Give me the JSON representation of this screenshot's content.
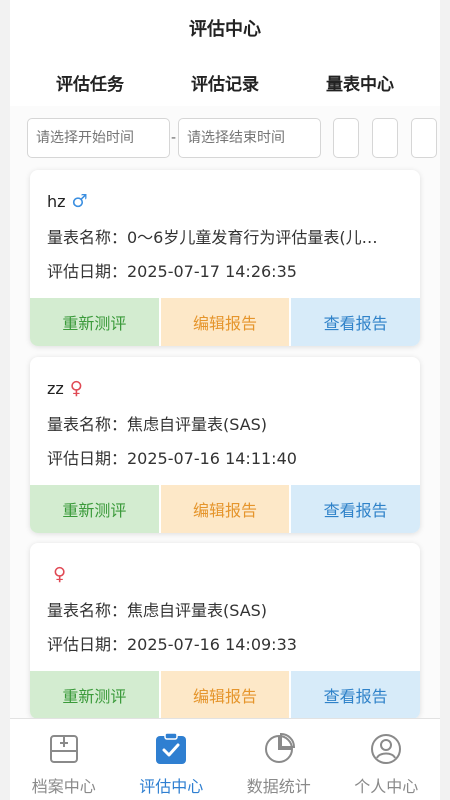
{
  "header": {
    "title": "评估中心"
  },
  "tabs": [
    {
      "label": "评估任务"
    },
    {
      "label": "评估记录"
    },
    {
      "label": "量表中心"
    }
  ],
  "active_tab": "评估记录",
  "filter": {
    "start_placeholder": "请选择开始时间",
    "end_placeholder": "请选择结束时间",
    "separator": "-"
  },
  "records": [
    {
      "name": "hz",
      "gender_symbol": "♂",
      "gender": "male",
      "scale_line": "量表名称：0～6岁儿童发育行为评估量表(儿…",
      "date_line": "评估日期：2025-07-17 14:26:35"
    },
    {
      "name": "zz",
      "gender_symbol": "♀",
      "gender": "female",
      "scale_line": "量表名称：焦虑自评量表(SAS)",
      "date_line": "评估日期：2025-07-16 14:11:40"
    },
    {
      "name": "",
      "gender_symbol": "♀",
      "gender": "female",
      "scale_line": "量表名称：焦虑自评量表(SAS)",
      "date_line": "评估日期：2025-07-16 14:09:33"
    }
  ],
  "actions": {
    "retest": "重新测评",
    "edit": "编辑报告",
    "view": "查看报告"
  },
  "colors": {
    "accent": "#2f7fd1",
    "male": "#3a8ee0",
    "female": "#e04a55",
    "retest_bg": "#d3ecd0",
    "edit_bg": "#fde8c8",
    "view_bg": "#d7ebf9"
  },
  "nav": [
    {
      "label": "档案中心",
      "icon": "archive-icon"
    },
    {
      "label": "评估中心",
      "icon": "assessment-icon"
    },
    {
      "label": "数据统计",
      "icon": "pie-chart-icon"
    },
    {
      "label": "个人中心",
      "icon": "user-icon"
    }
  ],
  "active_nav": "评估中心"
}
